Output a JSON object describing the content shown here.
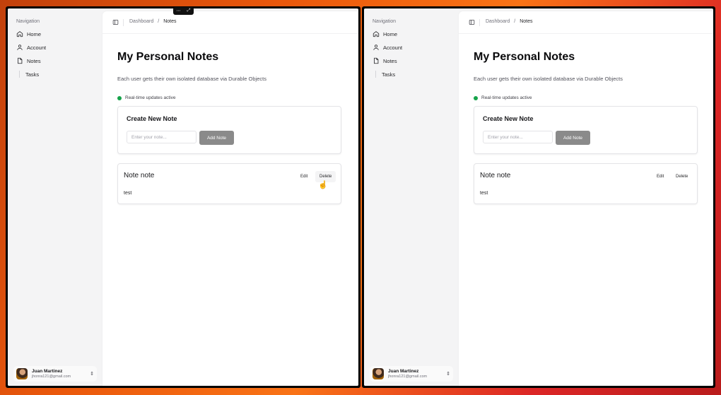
{
  "windows": [
    {
      "sidebar": {
        "heading": "Navigation",
        "items": [
          {
            "label": "Home",
            "icon": "home-icon"
          },
          {
            "label": "Account",
            "icon": "user-icon"
          },
          {
            "label": "Notes",
            "icon": "file-icon"
          }
        ],
        "sub_items": [
          {
            "label": "Tasks"
          }
        ]
      },
      "user": {
        "name": "Juan Martinez",
        "email": "jhonra121@gmail.com"
      },
      "breadcrumb": {
        "parent": "Dashboard",
        "sep": "/",
        "current": "Notes"
      },
      "page": {
        "title": "My Personal Notes",
        "subtitle": "Each user gets their own isolated database via Durable Objects",
        "realtime": "Real-time updates active"
      },
      "create": {
        "title": "Create New Note",
        "placeholder": "Enter your note...",
        "button": "Add Note"
      },
      "notes": [
        {
          "title": "Note note",
          "body": "test",
          "edit": "Edit",
          "delete": "Delete"
        }
      ]
    },
    {
      "sidebar": {
        "heading": "Navigation",
        "items": [
          {
            "label": "Home",
            "icon": "home-icon"
          },
          {
            "label": "Account",
            "icon": "user-icon"
          },
          {
            "label": "Notes",
            "icon": "file-icon"
          }
        ],
        "sub_items": [
          {
            "label": "Tasks"
          }
        ]
      },
      "user": {
        "name": "Juan Martinez",
        "email": "jhonra121@gmail.com"
      },
      "breadcrumb": {
        "parent": "Dashboard",
        "sep": "/",
        "current": "Notes"
      },
      "page": {
        "title": "My Personal Notes",
        "subtitle": "Each user gets their own isolated database via Durable Objects",
        "realtime": "Real-time updates active"
      },
      "create": {
        "title": "Create New Note",
        "placeholder": "Enter your note...",
        "button": "Add Note"
      },
      "notes": [
        {
          "title": "Note note",
          "body": "test",
          "edit": "Edit",
          "delete": "Delete"
        }
      ]
    }
  ],
  "colors": {
    "status_dot": "#16a34a",
    "add_button": "#8a8a8a",
    "desktop": "#ea580c"
  }
}
